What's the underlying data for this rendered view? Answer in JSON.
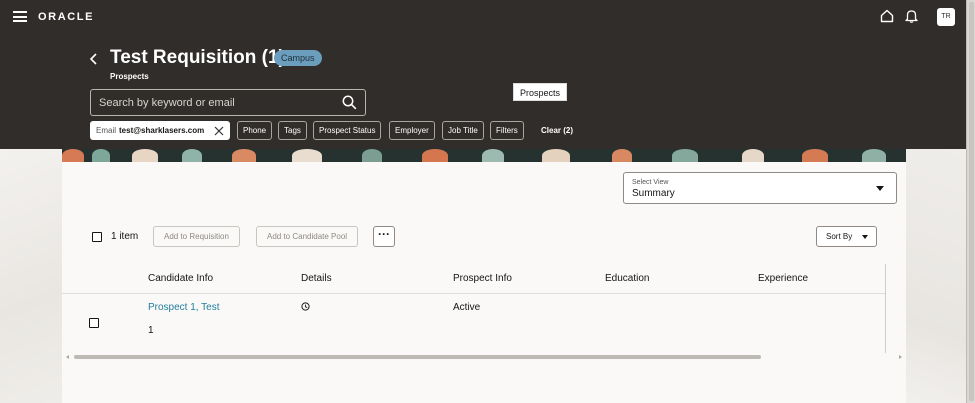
{
  "header": {
    "brand": "ORACLE",
    "avatar_initials": "TR",
    "icons": [
      "hamburger-menu-icon",
      "home-icon",
      "bell-icon"
    ]
  },
  "page": {
    "title": "Test Requisition (1)",
    "badge": "Campus",
    "subtitle": "Prospects",
    "tooltip": "Prospects"
  },
  "search": {
    "placeholder": "Search by keyword or email"
  },
  "filters": {
    "email_chip_label": "Email",
    "email_chip_value": "test@sharklasers.com",
    "chips": [
      "Phone",
      "Tags",
      "Prospect Status",
      "Employer",
      "Job Title",
      "Filters"
    ],
    "clear_label": "Clear (2)"
  },
  "view": {
    "label": "Select View",
    "value": "Summary"
  },
  "toolbar": {
    "item_count": "1 item",
    "add_to_requisition": "Add to Requisition",
    "add_to_candidate_pool": "Add to Candidate Pool",
    "more_label": "···",
    "sort_label": "Sort By"
  },
  "table": {
    "columns": [
      "Candidate Info",
      "Details",
      "Prospect Info",
      "Education",
      "Experience"
    ],
    "rows": [
      {
        "name": "Prospect 1, Test",
        "number": "1",
        "status": "Active"
      }
    ]
  },
  "colors": {
    "header_bg": "#312d2a",
    "badge_bg": "#6b9dbd",
    "link": "#227e9e",
    "content_bg": "#fbf9f8"
  }
}
